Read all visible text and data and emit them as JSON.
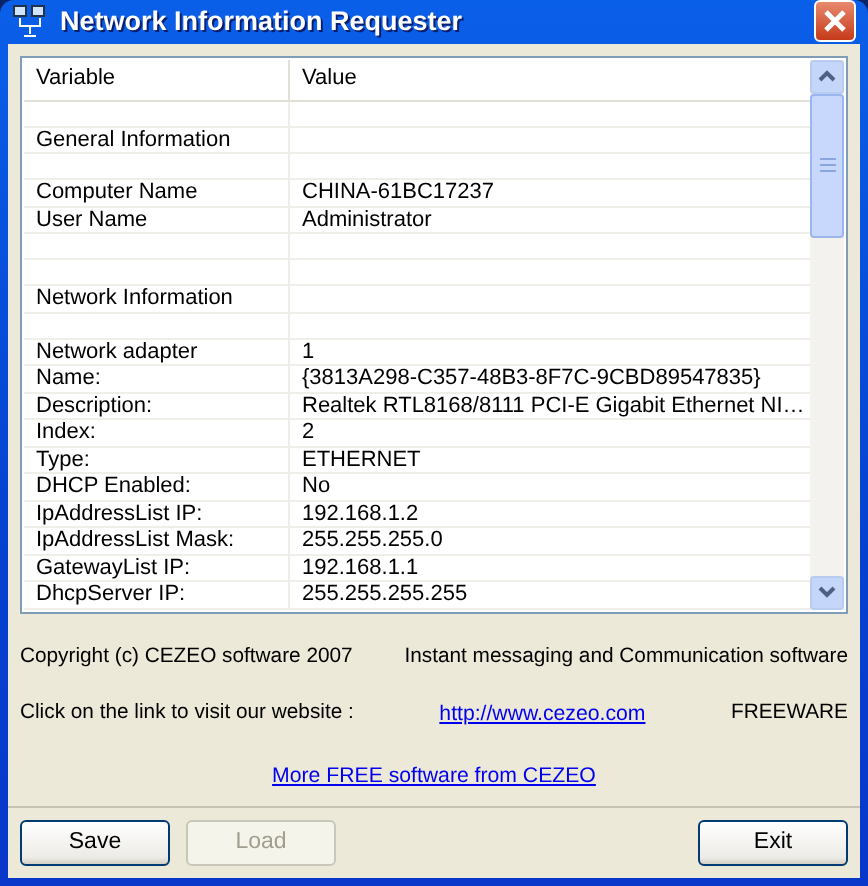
{
  "window": {
    "title": "Network Information Requester"
  },
  "table": {
    "columns": [
      "Variable",
      "Value"
    ],
    "rows": [
      {
        "kind": "blank"
      },
      {
        "kind": "data",
        "variable": "General Information"
      },
      {
        "kind": "blank"
      },
      {
        "kind": "data",
        "variable": "Computer Name",
        "value": "CHINA-61BC17237"
      },
      {
        "kind": "data",
        "variable": "User Name",
        "value": "Administrator"
      },
      {
        "kind": "blank"
      },
      {
        "kind": "blank"
      },
      {
        "kind": "data",
        "variable": "Network Information"
      },
      {
        "kind": "blank"
      },
      {
        "kind": "data",
        "variable": "Network adapter",
        "value": "1"
      },
      {
        "kind": "data",
        "variable": "Name:",
        "value": "{3813A298-C357-48B3-8F7C-9CBD89547835}"
      },
      {
        "kind": "data",
        "variable": "Description:",
        "value": "Realtek RTL8168/8111 PCI-E Gigabit Ethernet NI…"
      },
      {
        "kind": "data",
        "variable": "Index:",
        "value": "2"
      },
      {
        "kind": "data",
        "variable": "Type:",
        "value": "ETHERNET"
      },
      {
        "kind": "data",
        "variable": "DHCP Enabled:",
        "value": "No"
      },
      {
        "kind": "data",
        "variable": "IpAddressList IP:",
        "value": "192.168.1.2"
      },
      {
        "kind": "data",
        "variable": "IpAddressList Mask:",
        "value": "255.255.255.0"
      },
      {
        "kind": "data",
        "variable": "GatewayList IP:",
        "value": "192.168.1.1"
      },
      {
        "kind": "data",
        "variable": "DhcpServer IP:",
        "value": "255.255.255.255"
      }
    ]
  },
  "footer": {
    "copyright": "Copyright (c) CEZEO software 2007",
    "tagline": "Instant messaging and Communication software",
    "link_prompt": "Click on the link to visit our website :",
    "website_link": "http://www.cezeo.com",
    "license": "FREEWARE",
    "more_link": "More FREE software from CEZEO"
  },
  "buttons": [
    {
      "label": "Save",
      "disabled": false
    },
    {
      "label": "Load",
      "disabled": true
    },
    {
      "label": "Exit",
      "disabled": false
    }
  ]
}
